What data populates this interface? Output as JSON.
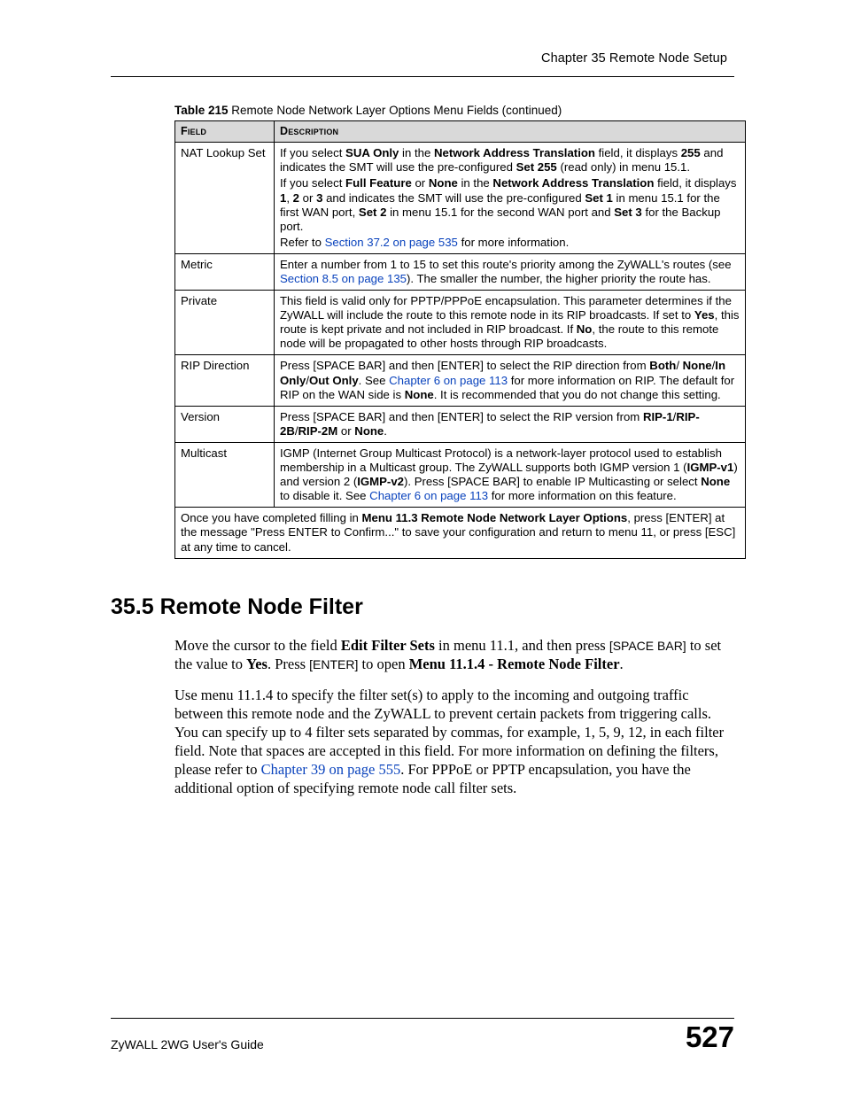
{
  "header": {
    "chapter": "Chapter 35 Remote Node Setup"
  },
  "table": {
    "caption_label": "Table 215",
    "caption_rest": "   Remote Node Network Layer Options Menu Fields (continued)",
    "head_field": "Field",
    "head_desc": "Description"
  },
  "rows": {
    "nat": {
      "field": "NAT Lookup Set",
      "p1a": "If you select ",
      "p1b": "SUA Only",
      "p1c": " in the ",
      "p1d": "Network Address Translation",
      "p1e": " field, it displays ",
      "p1f": "255",
      "p1g": " and indicates the SMT will use the pre-configured ",
      "p1h": "Set 255",
      "p1i": " (read only) in menu 15.1.",
      "p2a": "If you select ",
      "p2b": "Full Feature",
      "p2c": " or ",
      "p2d": "None",
      "p2e": " in the ",
      "p2f": "Network Address Translation",
      "p2g": " field, it displays ",
      "p2h": "1",
      "p2i": ", ",
      "p2j": "2",
      "p2k": " or ",
      "p2l": "3",
      "p2m": " and indicates the SMT will use the pre-configured ",
      "p2n": "Set 1",
      "p2o": " in menu 15.1 for the first WAN port,  ",
      "p2p": "Set 2",
      "p2q": " in menu 15.1 for the second WAN port and ",
      "p2r": "Set 3",
      "p2s": " for the Backup port.",
      "p3a": "Refer to ",
      "p3link": "Section 37.2 on page 535",
      "p3b": " for more information."
    },
    "metric": {
      "field": "Metric",
      "p1a": "Enter a number from 1 to 15 to set this route's priority among the ZyWALL's routes (see ",
      "p1link": "Section 8.5 on page 135",
      "p1b": "). The smaller the number, the higher priority the route has."
    },
    "private": {
      "field": "Private",
      "p1a": "This field is valid only for PPTP/PPPoE encapsulation. This parameter determines if the ZyWALL will include the route to this remote node in its RIP broadcasts. If set to ",
      "p1b": "Yes",
      "p1c": ", this route is kept private and not included in RIP broadcast. If ",
      "p1d": "No",
      "p1e": ", the route to this remote node will be propagated to other hosts through RIP broadcasts."
    },
    "rip": {
      "field": "RIP Direction",
      "p1a": "Press [SPACE BAR] and then [ENTER] to select the RIP direction from ",
      "p1b": "Both",
      "p1c": "/ ",
      "p1d": "None",
      "p1e": "/",
      "p1f": "In Only",
      "p1g": "/",
      "p1h": "Out Only",
      "p1i": ". See ",
      "p1link": "Chapter 6 on page 113",
      "p1j": " for more information on RIP. The default for RIP on the WAN side is ",
      "p1k": "None",
      "p1l": ". It is recommended that you do not change this setting."
    },
    "version": {
      "field": "Version",
      "p1a": "Press [SPACE BAR] and then [ENTER] to select the RIP version from ",
      "p1b": "RIP-1",
      "p1c": "/",
      "p1d": "RIP-2B",
      "p1e": "/",
      "p1f": "RIP-2M",
      "p1g": " or ",
      "p1h": "None",
      "p1i": "."
    },
    "multicast": {
      "field": "Multicast",
      "p1a": "IGMP (Internet Group Multicast Protocol) is a network-layer protocol used to establish membership in a Multicast group. The ZyWALL supports both IGMP version 1 (",
      "p1b": "IGMP-v1",
      "p1c": ") and version 2 (",
      "p1d": "IGMP-v2",
      "p1e": "). Press [SPACE BAR] to enable IP Multicasting or select ",
      "p1f": "None",
      "p1g": " to disable it. See ",
      "p1link": "Chapter 6 on page 113",
      "p1h": " for more information on this feature."
    },
    "footnote": {
      "p1a": "Once you have completed filling in ",
      "p1b": "Menu 11.3 Remote Node Network Layer Options",
      "p1c": ", press [ENTER] at the message \"Press ENTER to Confirm...\" to save your configuration and return to menu 11, or press [ESC] at any time to cancel."
    }
  },
  "section": {
    "heading": "35.5  Remote Node Filter",
    "p1a": "Move the cursor to the field ",
    "p1b": "Edit Filter Sets",
    "p1c": " in menu 11.1, and then press ",
    "p1sc1": "[SPACE BAR]",
    "p1d": " to set the value to ",
    "p1e": "Yes",
    "p1f": ". Press ",
    "p1sc2": "[ENTER]",
    "p1g": " to open ",
    "p1h": "Menu 11.1.4 - Remote Node Filter",
    "p1i": ".",
    "p2a": "Use menu 11.1.4 to specify the filter set(s) to apply to the incoming and outgoing traffic between this remote node and the ZyWALL to prevent certain packets from triggering calls. You can specify up to 4 filter sets separated by commas, for example, 1, 5, 9, 12, in each filter field. Note that spaces are accepted in this field. For more information on defining the filters, please refer to ",
    "p2link": "Chapter 39 on page 555",
    "p2b": ". For PPPoE or PPTP encapsulation, you have the additional option of specifying remote node call filter sets."
  },
  "footer": {
    "guide": "ZyWALL 2WG User's Guide",
    "page": "527"
  }
}
